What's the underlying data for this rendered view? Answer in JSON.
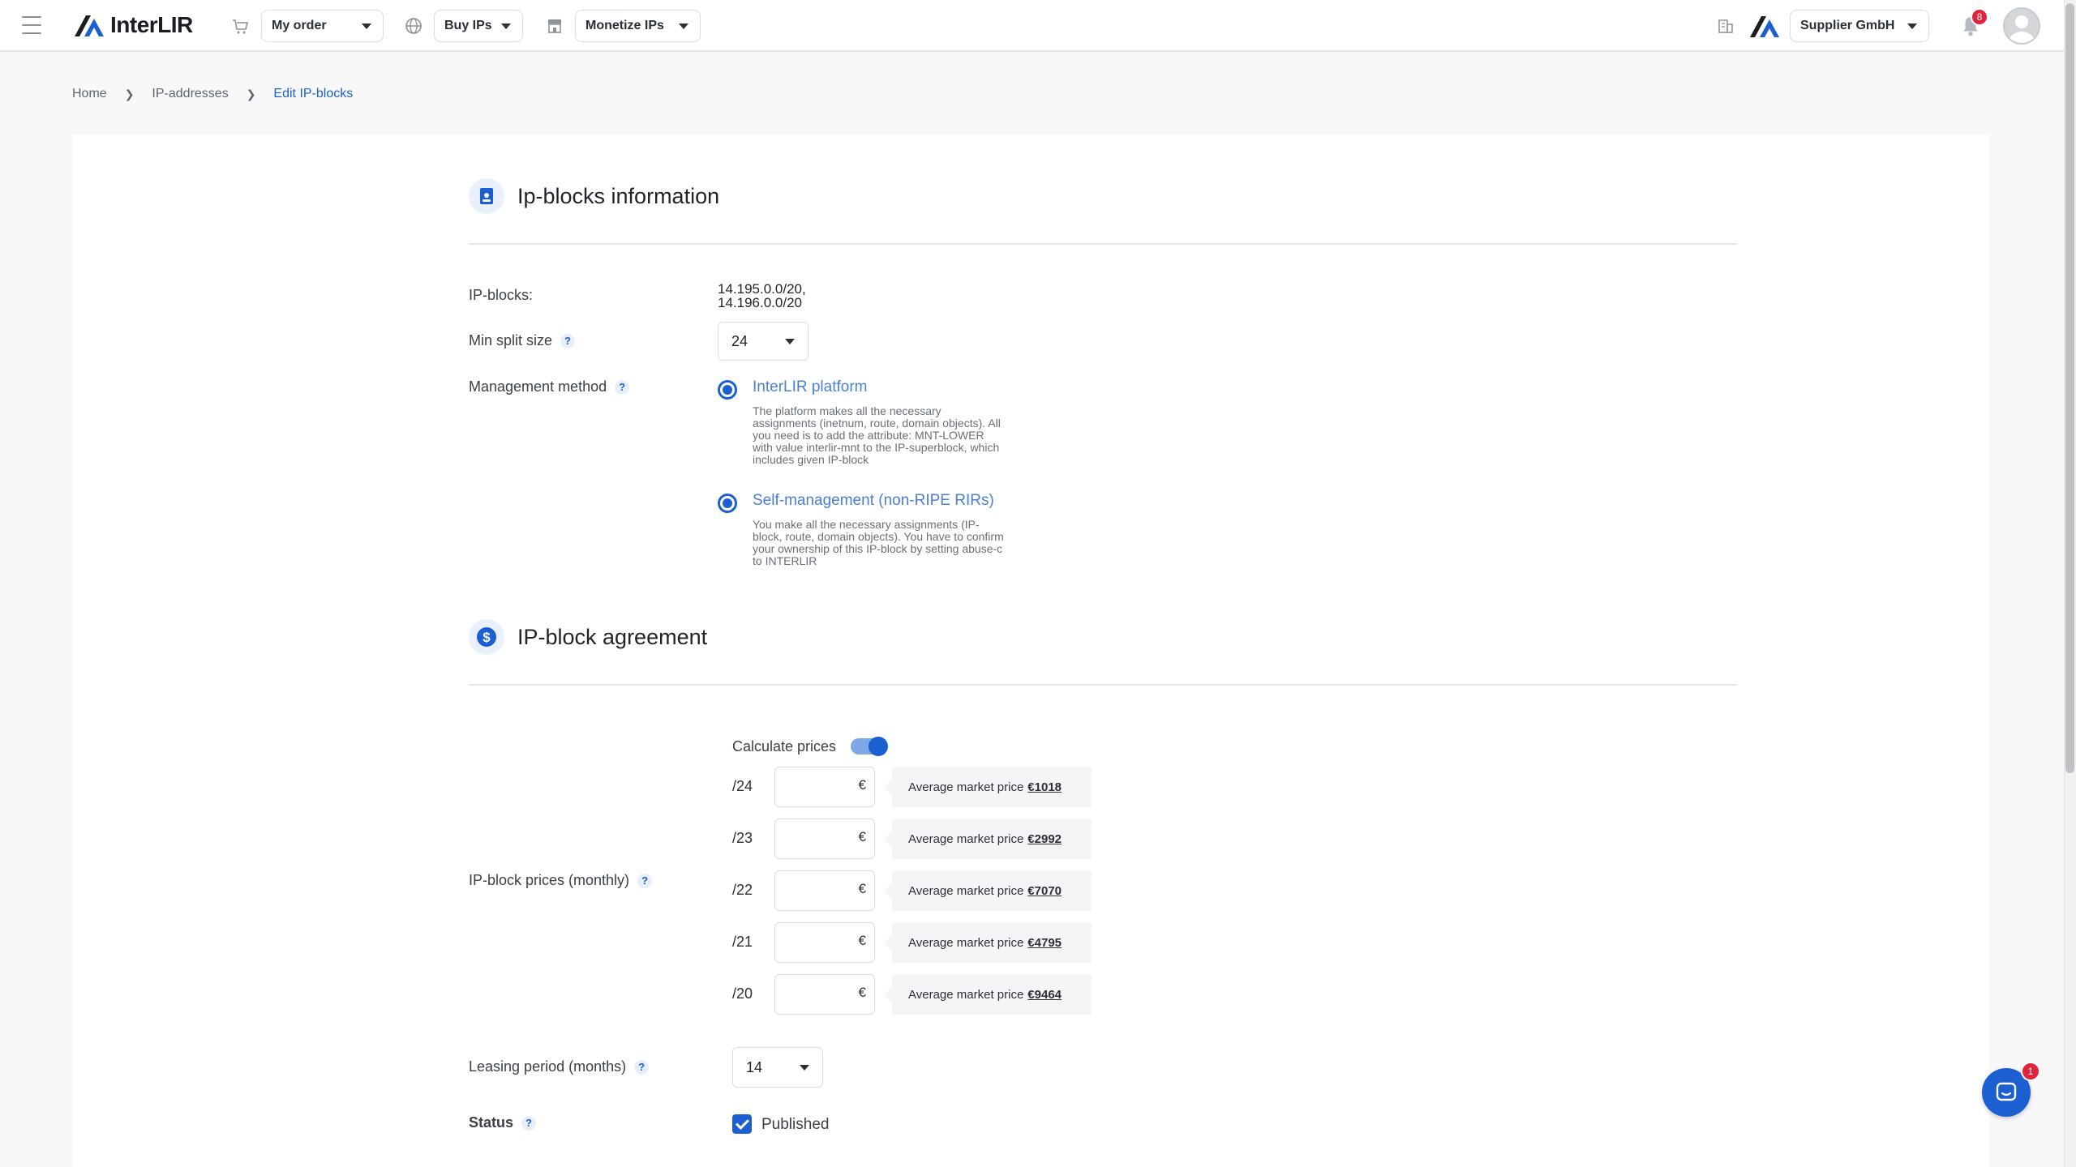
{
  "header": {
    "brand": "InterLIR",
    "nav": [
      {
        "label": "My order",
        "icon": "cart-icon"
      },
      {
        "label": "Buy IPs",
        "icon": "globe-icon"
      },
      {
        "label": "Monetize IPs",
        "icon": "store-icon"
      }
    ],
    "company": "Supplier GmbH",
    "notifications_count": "8"
  },
  "breadcrumb": {
    "home": "Home",
    "section": "IP-addresses",
    "current": "Edit IP-blocks"
  },
  "info_section": {
    "title": "Ip-blocks information",
    "ip_blocks_label": "IP-blocks:",
    "ip_blocks_line1": "14.195.0.0/20,",
    "ip_blocks_line2": "14.196.0.0/20",
    "min_split_label": "Min split size",
    "min_split_value": "24",
    "management_label": "Management method",
    "option_platform_title": "InterLIR platform",
    "option_platform_desc": "The platform makes all the necessary assignments (inetnum, route, domain objects). All you need is to add the attribute: MNT-LOWER with value interlir-mnt to the IP-superblock, which includes given IP-block",
    "option_self_title": "Self-management (non-RIPE RIRs)",
    "option_self_desc": "You make all the necessary assignments (IP-block, route, domain objects). You have to confirm your ownership of this IP-block by setting abuse-c to INTERLIR"
  },
  "agreement_section": {
    "title": "IP-block agreement",
    "calculate_prices_label": "Calculate prices",
    "calculate_prices_on": true,
    "prices_label": "IP-block prices (monthly)",
    "currency_symbol": "€",
    "market_label": "Average market price",
    "prices": [
      {
        "size": "/24",
        "value": "",
        "market": "€1018"
      },
      {
        "size": "/23",
        "value": "",
        "market": "€2992"
      },
      {
        "size": "/22",
        "value": "",
        "market": "€7070"
      },
      {
        "size": "/21",
        "value": "",
        "market": "€4795"
      },
      {
        "size": "/20",
        "value": "",
        "market": "€9464"
      }
    ],
    "leasing_label": "Leasing period (months)",
    "leasing_value": "14",
    "status_label": "Status",
    "status_value": "Published"
  },
  "chat": {
    "unread": "1"
  },
  "colors": {
    "accent": "#1b5fd1",
    "badge": "#e0243c"
  }
}
